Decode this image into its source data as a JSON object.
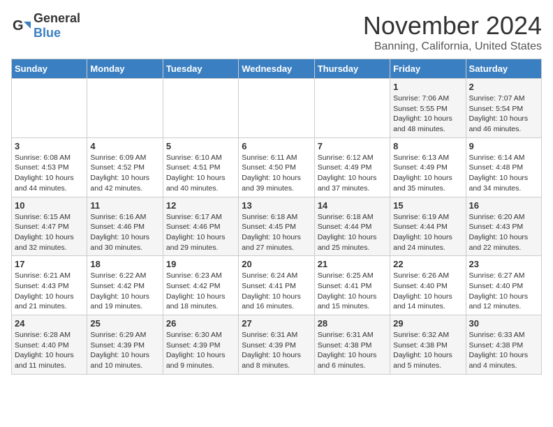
{
  "header": {
    "logo_general": "General",
    "logo_blue": "Blue",
    "month_title": "November 2024",
    "location": "Banning, California, United States"
  },
  "days_of_week": [
    "Sunday",
    "Monday",
    "Tuesday",
    "Wednesday",
    "Thursday",
    "Friday",
    "Saturday"
  ],
  "weeks": [
    [
      {
        "day": "",
        "sunrise": "",
        "sunset": "",
        "daylight": ""
      },
      {
        "day": "",
        "sunrise": "",
        "sunset": "",
        "daylight": ""
      },
      {
        "day": "",
        "sunrise": "",
        "sunset": "",
        "daylight": ""
      },
      {
        "day": "",
        "sunrise": "",
        "sunset": "",
        "daylight": ""
      },
      {
        "day": "",
        "sunrise": "",
        "sunset": "",
        "daylight": ""
      },
      {
        "day": "1",
        "sunrise": "Sunrise: 7:06 AM",
        "sunset": "Sunset: 5:55 PM",
        "daylight": "Daylight: 10 hours and 48 minutes."
      },
      {
        "day": "2",
        "sunrise": "Sunrise: 7:07 AM",
        "sunset": "Sunset: 5:54 PM",
        "daylight": "Daylight: 10 hours and 46 minutes."
      }
    ],
    [
      {
        "day": "3",
        "sunrise": "Sunrise: 6:08 AM",
        "sunset": "Sunset: 4:53 PM",
        "daylight": "Daylight: 10 hours and 44 minutes."
      },
      {
        "day": "4",
        "sunrise": "Sunrise: 6:09 AM",
        "sunset": "Sunset: 4:52 PM",
        "daylight": "Daylight: 10 hours and 42 minutes."
      },
      {
        "day": "5",
        "sunrise": "Sunrise: 6:10 AM",
        "sunset": "Sunset: 4:51 PM",
        "daylight": "Daylight: 10 hours and 40 minutes."
      },
      {
        "day": "6",
        "sunrise": "Sunrise: 6:11 AM",
        "sunset": "Sunset: 4:50 PM",
        "daylight": "Daylight: 10 hours and 39 minutes."
      },
      {
        "day": "7",
        "sunrise": "Sunrise: 6:12 AM",
        "sunset": "Sunset: 4:49 PM",
        "daylight": "Daylight: 10 hours and 37 minutes."
      },
      {
        "day": "8",
        "sunrise": "Sunrise: 6:13 AM",
        "sunset": "Sunset: 4:49 PM",
        "daylight": "Daylight: 10 hours and 35 minutes."
      },
      {
        "day": "9",
        "sunrise": "Sunrise: 6:14 AM",
        "sunset": "Sunset: 4:48 PM",
        "daylight": "Daylight: 10 hours and 34 minutes."
      }
    ],
    [
      {
        "day": "10",
        "sunrise": "Sunrise: 6:15 AM",
        "sunset": "Sunset: 4:47 PM",
        "daylight": "Daylight: 10 hours and 32 minutes."
      },
      {
        "day": "11",
        "sunrise": "Sunrise: 6:16 AM",
        "sunset": "Sunset: 4:46 PM",
        "daylight": "Daylight: 10 hours and 30 minutes."
      },
      {
        "day": "12",
        "sunrise": "Sunrise: 6:17 AM",
        "sunset": "Sunset: 4:46 PM",
        "daylight": "Daylight: 10 hours and 29 minutes."
      },
      {
        "day": "13",
        "sunrise": "Sunrise: 6:18 AM",
        "sunset": "Sunset: 4:45 PM",
        "daylight": "Daylight: 10 hours and 27 minutes."
      },
      {
        "day": "14",
        "sunrise": "Sunrise: 6:18 AM",
        "sunset": "Sunset: 4:44 PM",
        "daylight": "Daylight: 10 hours and 25 minutes."
      },
      {
        "day": "15",
        "sunrise": "Sunrise: 6:19 AM",
        "sunset": "Sunset: 4:44 PM",
        "daylight": "Daylight: 10 hours and 24 minutes."
      },
      {
        "day": "16",
        "sunrise": "Sunrise: 6:20 AM",
        "sunset": "Sunset: 4:43 PM",
        "daylight": "Daylight: 10 hours and 22 minutes."
      }
    ],
    [
      {
        "day": "17",
        "sunrise": "Sunrise: 6:21 AM",
        "sunset": "Sunset: 4:43 PM",
        "daylight": "Daylight: 10 hours and 21 minutes."
      },
      {
        "day": "18",
        "sunrise": "Sunrise: 6:22 AM",
        "sunset": "Sunset: 4:42 PM",
        "daylight": "Daylight: 10 hours and 19 minutes."
      },
      {
        "day": "19",
        "sunrise": "Sunrise: 6:23 AM",
        "sunset": "Sunset: 4:42 PM",
        "daylight": "Daylight: 10 hours and 18 minutes."
      },
      {
        "day": "20",
        "sunrise": "Sunrise: 6:24 AM",
        "sunset": "Sunset: 4:41 PM",
        "daylight": "Daylight: 10 hours and 16 minutes."
      },
      {
        "day": "21",
        "sunrise": "Sunrise: 6:25 AM",
        "sunset": "Sunset: 4:41 PM",
        "daylight": "Daylight: 10 hours and 15 minutes."
      },
      {
        "day": "22",
        "sunrise": "Sunrise: 6:26 AM",
        "sunset": "Sunset: 4:40 PM",
        "daylight": "Daylight: 10 hours and 14 minutes."
      },
      {
        "day": "23",
        "sunrise": "Sunrise: 6:27 AM",
        "sunset": "Sunset: 4:40 PM",
        "daylight": "Daylight: 10 hours and 12 minutes."
      }
    ],
    [
      {
        "day": "24",
        "sunrise": "Sunrise: 6:28 AM",
        "sunset": "Sunset: 4:40 PM",
        "daylight": "Daylight: 10 hours and 11 minutes."
      },
      {
        "day": "25",
        "sunrise": "Sunrise: 6:29 AM",
        "sunset": "Sunset: 4:39 PM",
        "daylight": "Daylight: 10 hours and 10 minutes."
      },
      {
        "day": "26",
        "sunrise": "Sunrise: 6:30 AM",
        "sunset": "Sunset: 4:39 PM",
        "daylight": "Daylight: 10 hours and 9 minutes."
      },
      {
        "day": "27",
        "sunrise": "Sunrise: 6:31 AM",
        "sunset": "Sunset: 4:39 PM",
        "daylight": "Daylight: 10 hours and 8 minutes."
      },
      {
        "day": "28",
        "sunrise": "Sunrise: 6:31 AM",
        "sunset": "Sunset: 4:38 PM",
        "daylight": "Daylight: 10 hours and 6 minutes."
      },
      {
        "day": "29",
        "sunrise": "Sunrise: 6:32 AM",
        "sunset": "Sunset: 4:38 PM",
        "daylight": "Daylight: 10 hours and 5 minutes."
      },
      {
        "day": "30",
        "sunrise": "Sunrise: 6:33 AM",
        "sunset": "Sunset: 4:38 PM",
        "daylight": "Daylight: 10 hours and 4 minutes."
      }
    ]
  ]
}
